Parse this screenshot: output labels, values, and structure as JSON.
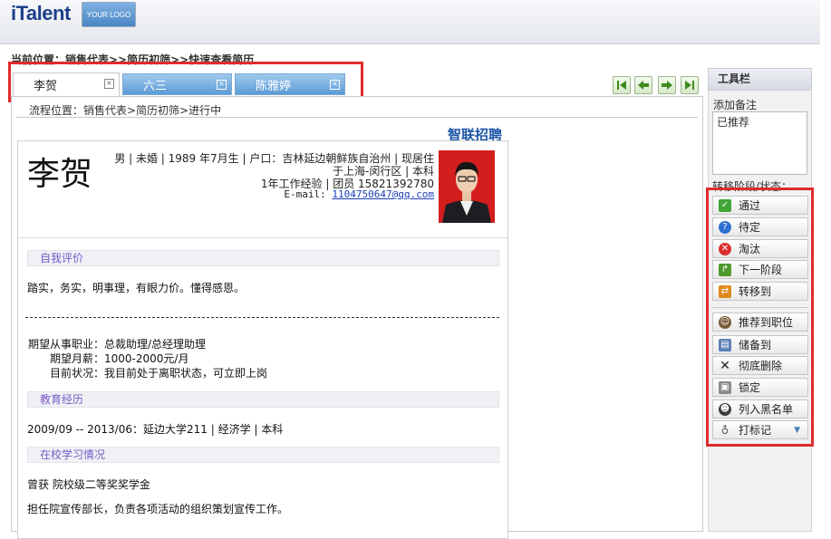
{
  "header": {
    "brand": "iTalent",
    "logo_text": "YOUR LOGO"
  },
  "breadcrumb": "当前位置：销售代表>>简历初筛>>快速查看简历",
  "tabs": [
    {
      "label": "李贺",
      "active": true
    },
    {
      "label": "六三",
      "active": false
    },
    {
      "label": "陈雅婷",
      "active": false
    }
  ],
  "tab_close_glyph": "⊠",
  "process_line": "流程位置：销售代表>简历初筛>进行中",
  "source_label": "智联招聘",
  "resume": {
    "name": "李贺",
    "info_line1": "男 | 未婚 | 1989 年7月生 | 户口：吉林延边朝鲜族自治州 | 现居住",
    "info_line2": "于上海-闵行区 | 本科",
    "info_line3": "1年工作经验 | 团员 15821392780",
    "email_label": "E-mail:",
    "email": "1104750647@qq.com",
    "sections": {
      "self_eval": "自我评价",
      "education": "教育经历",
      "campus": "在校学习情况"
    },
    "self_eval_text": "踏实，务实，明事理，有眼力价。懂得感恩。",
    "expect_job": "期望从事职业：总裁助理/总经理助理",
    "expect_salary": "期望月薪：1000-2000元/月",
    "status": "目前状况：我目前处于离职状态，可立即上岗",
    "education_text": "2009/09 -- 2013/06：延边大学211 | 经济学 | 本科",
    "campus_line1": "曾获 院校级二等奖奖学金",
    "campus_line2": "担任院宣传部长，负责各项活动的组织策划宣传工作。"
  },
  "toolbar": {
    "title": "工具栏",
    "note_label": "添加备注",
    "note_value": "已推荐",
    "stage_label": "转移阶段/状态：",
    "stage_actions": [
      {
        "label": "通过",
        "icon": "check-icon",
        "color": "#3fa535"
      },
      {
        "label": "待定",
        "icon": "question-icon",
        "color": "#2f6fd0"
      },
      {
        "label": "淘汰",
        "icon": "reject-icon",
        "color": "#d93030"
      },
      {
        "label": "下一阶段",
        "icon": "next-stage-icon",
        "color": "#4f9a2c"
      },
      {
        "label": "转移到",
        "icon": "transfer-icon",
        "color": "#e08a1e"
      }
    ],
    "other_actions": [
      {
        "label": "推荐到职位",
        "icon": "recommend-person-icon"
      },
      {
        "label": "储备到",
        "icon": "reserve-icon"
      },
      {
        "label": "彻底删除",
        "icon": "delete-x-icon"
      },
      {
        "label": "锁定",
        "icon": "lock-icon"
      },
      {
        "label": "列入黑名单",
        "icon": "blacklist-person-icon"
      },
      {
        "label": "打标记",
        "icon": "tag-icon"
      }
    ]
  }
}
